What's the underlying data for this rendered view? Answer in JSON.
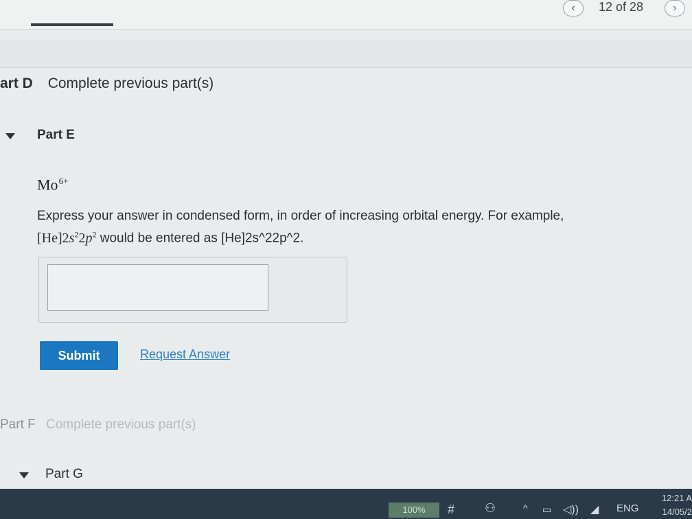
{
  "header": {
    "pager": "12 of 28",
    "prev_icon": "‹",
    "next_icon": "›"
  },
  "part_d": {
    "label": "art D",
    "message": "Complete previous part(s)"
  },
  "part_e": {
    "label": "Part E",
    "ion_symbol": "Mo",
    "ion_charge": "6+",
    "instructions_line1": "Express your answer in condensed form, in order of increasing orbital energy. For example,",
    "example_core": "[He]2",
    "example_s": "s",
    "example_s_exp": "2",
    "example_2": "2",
    "example_p": "p",
    "example_p_exp": "2",
    "instructions_line2": " would be entered as [He]2s^22p^2.",
    "answer_value": "",
    "submit_label": "Submit",
    "request_answer_label": "Request Answer"
  },
  "part_f": {
    "label": "Part F",
    "message": "Complete previous part(s)"
  },
  "part_g": {
    "label": "Part G"
  },
  "taskbar": {
    "battery": "100%",
    "hash_icon": "#",
    "people_icon": "⚇",
    "chevron_icon": "^",
    "keyboard_icon": "▭",
    "volume_icon": "◁))",
    "wifi_icon": "◢",
    "language": "ENG",
    "time": "12:21 A",
    "date": "14/05/2"
  }
}
